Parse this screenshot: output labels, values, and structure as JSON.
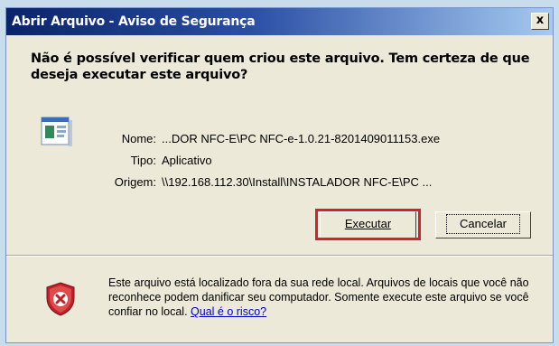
{
  "window": {
    "title": "Abrir Arquivo - Aviso de Segurança",
    "close_label": "x"
  },
  "question": "Não é possível verificar quem criou este arquivo. Tem certeza de que deseja executar este arquivo?",
  "fields": {
    "name_label": "Nome:",
    "name_value": "...DOR NFC-E\\PC NFC-e-1.0.21-8201409011153.exe",
    "type_label": "Tipo:",
    "type_value": "Aplicativo",
    "origin_label": "Origem:",
    "origin_value": "\\\\192.168.112.30\\Install\\INSTALADOR NFC-E\\PC ..."
  },
  "buttons": {
    "run_label": "Executar",
    "cancel_label": "Cancelar"
  },
  "warning": {
    "text": "Este arquivo está localizado fora da sua rede local. Arquivos de locais que você não reconhece podem danificar seu computador. Somente execute este arquivo se você confiar no local.",
    "link": "Qual é o risco?"
  },
  "icons": {
    "file": "application-file-icon",
    "shield": "security-shield-icon"
  },
  "colors": {
    "highlight": "#d8202a",
    "title_bar": "#0a246a",
    "link": "#0000cc"
  }
}
